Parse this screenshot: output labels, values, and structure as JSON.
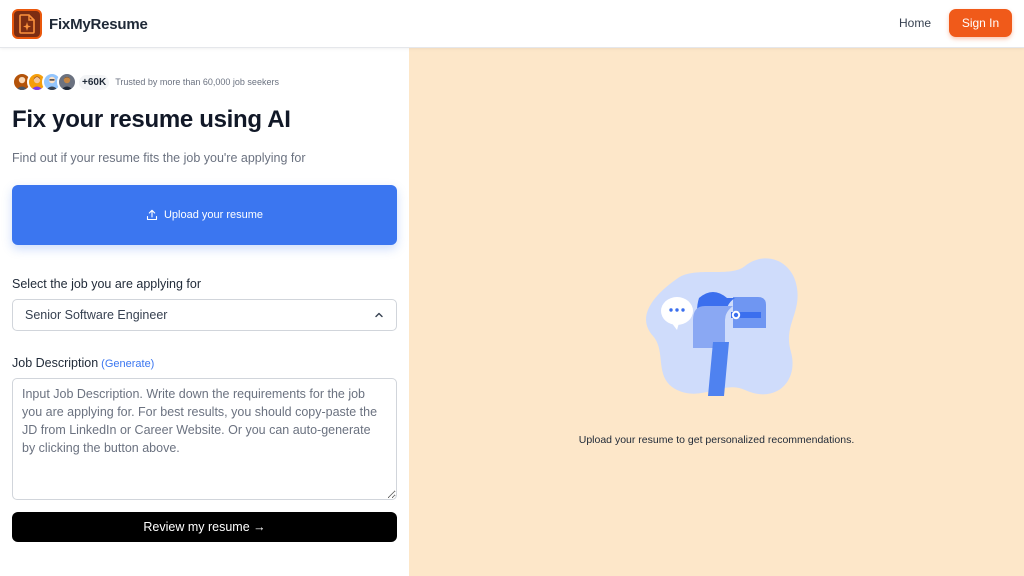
{
  "header": {
    "brand": "FixMyResume",
    "nav_home": "Home",
    "sign_in": "Sign In",
    "logo_icon": "document-sparkle-icon",
    "accent_color": "#f05a1a"
  },
  "hero": {
    "trust_count": "+60K",
    "trust_text": "Trusted by more than 60,000 job seekers",
    "title": "Fix your resume using AI",
    "subtitle": "Find out if your resume fits the job you're applying for"
  },
  "upload": {
    "label": "Upload your resume",
    "icon": "upload-icon",
    "color": "#3b76f0"
  },
  "job": {
    "label": "Select the job you are applying for",
    "selected": "Senior Software Engineer",
    "icon": "chevron-up-icon"
  },
  "description": {
    "label": "Job Description",
    "generate": "(Generate)",
    "placeholder": "Input Job Description. Write down the requirements for the job you are applying for. For best results, you should copy-paste the JD from LinkedIn or Career Website. Or you can auto-generate by clicking the button above."
  },
  "review": {
    "label": "Review my resume →"
  },
  "right_panel": {
    "caption": "Upload your resume to get personalized recommendations.",
    "illustration": "mailbox-illustration",
    "background": "#fde7c9"
  }
}
